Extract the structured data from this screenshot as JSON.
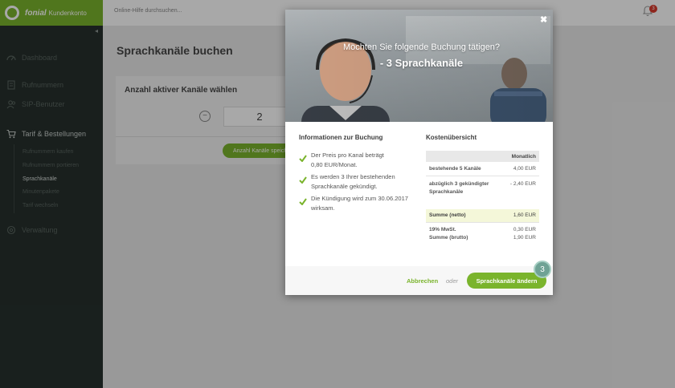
{
  "app": {
    "brand": "fonial",
    "title": "Kundenkonto"
  },
  "topbar": {
    "search_placeholder": "Online-Hilfe durchsuchen...",
    "notification_count": "3"
  },
  "sidebar": {
    "main_items": [
      {
        "label": "Dashboard",
        "icon": "dashboard-icon"
      },
      {
        "label": "Rufnummern",
        "icon": "phone-book-icon"
      },
      {
        "label": "SIP-Benutzer",
        "icon": "users-icon"
      },
      {
        "label": "Tarif & Bestellungen",
        "icon": "cart-icon"
      },
      {
        "label": "Verwaltung",
        "icon": "gear-icon"
      }
    ],
    "sub_items": [
      {
        "label": "Rufnummern kaufen"
      },
      {
        "label": "Rufnummern portieren"
      },
      {
        "label": "Sprachkanäle"
      },
      {
        "label": "Minutenpakete"
      },
      {
        "label": "Tarif wechseln"
      }
    ]
  },
  "page": {
    "title": "Sprachkanäle buchen",
    "panel_heading": "Anzahl aktiver Kanäle wählen",
    "channel_count": "2",
    "save_button": "Anzahl Kanäle speichern"
  },
  "modal": {
    "question": "Möchten Sie folgende Buchung tätigen?",
    "headline": "- 3 Sprachkanäle",
    "info": {
      "title": "Informationen zur Buchung",
      "items": [
        {
          "line1": "Der Preis pro Kanal beträgt",
          "line2": "0,80 EUR/Monat."
        },
        {
          "line1": "Es werden 3 Ihrer bestehenden",
          "line2": "Sprachkanäle gekündigt."
        },
        {
          "line1": "Die Kündigung wird zum 30.06.2017",
          "line2": "wirksam."
        }
      ]
    },
    "costs": {
      "title": "Kostenübersicht",
      "column_header": "Monatlich",
      "rows": [
        {
          "label": "bestehende 5 Kanäle",
          "value": "4,00 EUR"
        },
        {
          "label1": "abzüglich 3 gekündigter",
          "label2": "Sprachkanäle",
          "value": "- 2,40 EUR"
        }
      ],
      "net": {
        "label": "Summe (netto)",
        "value": "1,60 EUR"
      },
      "vat": {
        "label": "19% MwSt.",
        "value": "0,30 EUR"
      },
      "gross": {
        "label": "Summe (brutto)",
        "value": "1,90 EUR"
      }
    },
    "cancel_link": "Abbrechen",
    "or_text": "oder",
    "confirm_button": "Sprachkanäle ändern",
    "step_number": "3"
  }
}
